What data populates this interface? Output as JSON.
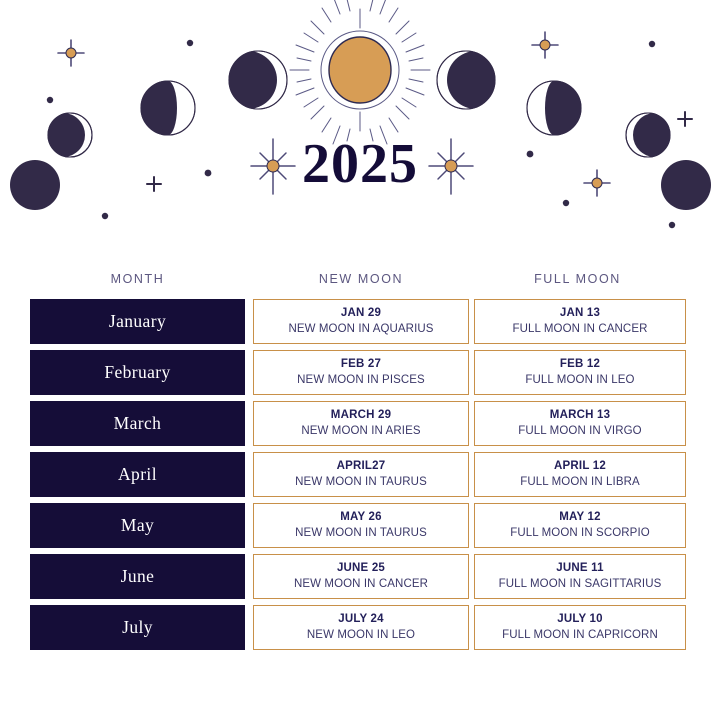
{
  "header": {
    "year": "2025",
    "sun_color": "#d79d55",
    "moon_dark_color": "#322a48",
    "accent_gold": "#c89049",
    "navy": "#150d38",
    "star_glyphs": [
      "four-point-star",
      "plus-star",
      "dot"
    ]
  },
  "table": {
    "columns": [
      "MONTH",
      "NEW MOON",
      "FULL MOON"
    ],
    "rows": [
      {
        "month": "January",
        "new_moon_date": "JAN 29",
        "new_moon_sign": "NEW MOON IN AQUARIUS",
        "full_moon_date": "JAN 13",
        "full_moon_sign": "FULL MOON IN CANCER"
      },
      {
        "month": "February",
        "new_moon_date": "FEB 27",
        "new_moon_sign": "NEW MOON IN PISCES",
        "full_moon_date": "FEB 12",
        "full_moon_sign": "FULL MOON IN LEO"
      },
      {
        "month": "March",
        "new_moon_date": "MARCH 29",
        "new_moon_sign": "NEW MOON IN ARIES",
        "full_moon_date": "MARCH 13",
        "full_moon_sign": "FULL MOON IN VIRGO"
      },
      {
        "month": "April",
        "new_moon_date": "APRIL27",
        "new_moon_sign": "NEW MOON IN TAURUS",
        "full_moon_date": "APRIL 12",
        "full_moon_sign": "FULL MOON IN LIBRA"
      },
      {
        "month": "May",
        "new_moon_date": "MAY 26",
        "new_moon_sign": "NEW MOON IN TAURUS",
        "full_moon_date": "MAY 12",
        "full_moon_sign": "FULL MOON IN SCORPIO"
      },
      {
        "month": "June",
        "new_moon_date": "JUNE 25",
        "new_moon_sign": "NEW MOON IN CANCER",
        "full_moon_date": "JUNE 11",
        "full_moon_sign": "FULL MOON IN SAGITTARIUS"
      },
      {
        "month": "July",
        "new_moon_date": "JULY 24",
        "new_moon_sign": "NEW MOON IN LEO",
        "full_moon_date": "JULY 10",
        "full_moon_sign": "FULL MOON IN CAPRICORN"
      }
    ]
  }
}
